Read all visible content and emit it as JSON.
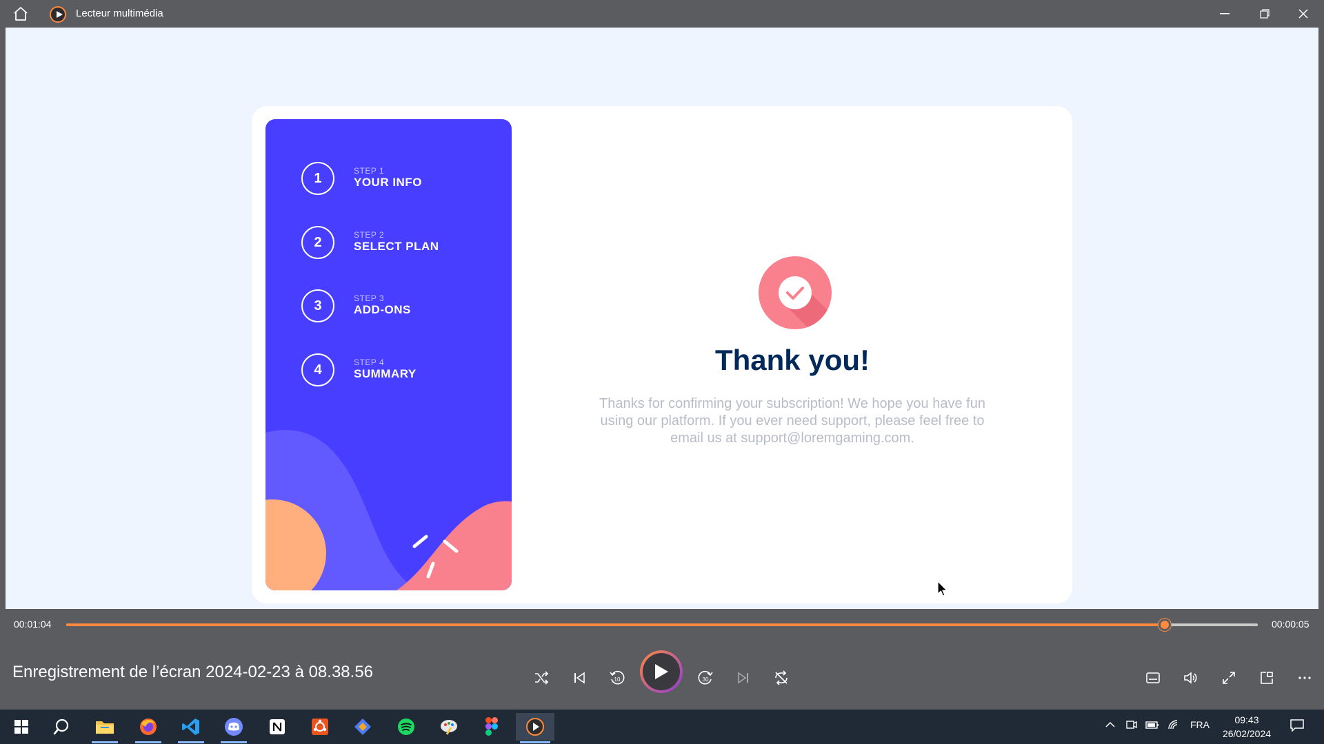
{
  "window": {
    "title": "Lecteur multimédia"
  },
  "video_frame": {
    "steps": [
      {
        "number": "1",
        "label": "STEP 1",
        "title": "YOUR INFO"
      },
      {
        "number": "2",
        "label": "STEP 2",
        "title": "SELECT PLAN"
      },
      {
        "number": "3",
        "label": "STEP 3",
        "title": "ADD-ONS"
      },
      {
        "number": "4",
        "label": "STEP 4",
        "title": "SUMMARY"
      }
    ],
    "heading": "Thank you!",
    "message": "Thanks for confirming your subscription! We hope you have fun using our platform. If you ever need support, please feel free to email us at support@loremgaming.com.",
    "colors": {
      "sidebar": "#483eff",
      "accent_red": "#f9818e",
      "heading": "#022959",
      "message": "#b8bcc8"
    }
  },
  "player": {
    "elapsed": "00:01:04",
    "remaining": "00:00:05",
    "progress": 0.922,
    "media_title": "Enregistrement de l’écran 2024-02-23 à 08.38.56",
    "accent": "#ff8a3d",
    "buttons": {
      "shuffle": "shuffle-icon",
      "previous": "previous-icon",
      "rewind": "rewind-10-icon",
      "play": "play-icon",
      "forward": "forward-30-icon",
      "next": "next-icon",
      "repeat": "repeat-icon",
      "subtitles": "subtitles-icon",
      "volume": "volume-icon",
      "fullscreen": "fullscreen-icon",
      "miniplayer": "miniplayer-icon",
      "more": "more-icon"
    },
    "rewind_seconds": "10",
    "forward_seconds": "30"
  },
  "taskbar": {
    "apps": [
      "windows-start",
      "search",
      "file-explorer",
      "firefox",
      "vscode",
      "discord",
      "notion",
      "ubuntu",
      "git-client",
      "spotify",
      "paint-app",
      "figma",
      "media-player"
    ],
    "language": "FRA",
    "time": "09:43",
    "date": "26/02/2024"
  }
}
